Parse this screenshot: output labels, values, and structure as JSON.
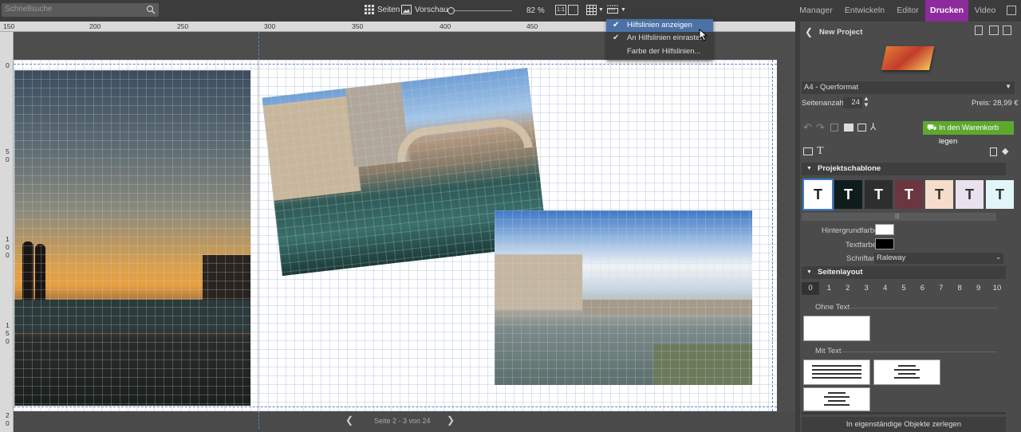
{
  "search": {
    "placeholder": "Schnellsuche"
  },
  "toolbar": {
    "pages_label": "Seiten",
    "preview_label": "Vorschau",
    "zoom": "82 %"
  },
  "modes": [
    "Manager",
    "Entwickeln",
    "Editor",
    "Drucken",
    "Video"
  ],
  "ruler_top": [
    "150",
    "200",
    "250",
    "300",
    "350",
    "400",
    "450"
  ],
  "ruler_left": [
    [
      "0"
    ],
    [
      "5",
      "0"
    ],
    [
      "1",
      "0",
      "0"
    ],
    [
      "1",
      "5",
      "0"
    ],
    [
      "2",
      "0"
    ]
  ],
  "dropdown": {
    "items": [
      {
        "label": "Hilfslinien anzeigen",
        "checked": true
      },
      {
        "label": "An Hilfslinien einrasten",
        "checked": true
      },
      {
        "label": "Farbe der Hilfslinien...",
        "checked": false
      }
    ]
  },
  "pager": {
    "label": "Seite 2 - 3 von 24"
  },
  "panel": {
    "project_title": "New Project",
    "format": "A4 - Querformat",
    "pages_label": "Seitenanzahl:",
    "pages_value": "24",
    "price": "Preis: 28,99 €",
    "cart": "In den Warenkorb legen",
    "template_section": "Projektschablone",
    "bg_color_label": "Hintergrundfarbe",
    "text_color_label": "Textfarbe",
    "font_label": "Schriftart",
    "font_value": "Raleway",
    "layout_section": "Seitenlayout",
    "layout_numbers": [
      "0",
      "1",
      "2",
      "3",
      "4",
      "5",
      "6",
      "7",
      "8",
      "9",
      "10"
    ],
    "no_text": "Ohne Text",
    "with_text": "Mit Text",
    "split_button": "In eigenständige Objekte zerlegen"
  },
  "tiles": [
    {
      "bg": "#ffffff",
      "fg": "#222"
    },
    {
      "bg": "#0f1c1c",
      "fg": "#fff"
    },
    {
      "bg": "#2e2e2e",
      "fg": "#fff"
    },
    {
      "bg": "#6b3640",
      "fg": "#fff"
    },
    {
      "bg": "#f5dccb",
      "fg": "#333"
    },
    {
      "bg": "#eae1ee",
      "fg": "#333"
    },
    {
      "bg": "#e2f5f8",
      "fg": "#333"
    }
  ],
  "colors": {
    "accent": "#8d2a9d",
    "cart_green": "#5ea831",
    "dropdown_highlight": "#4a72a6"
  }
}
